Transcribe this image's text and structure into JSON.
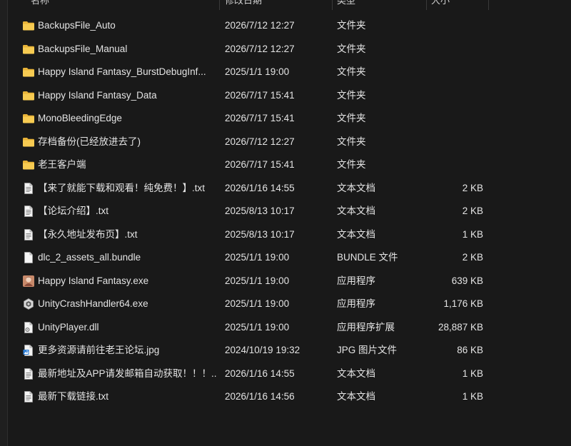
{
  "columns": {
    "name": "名称",
    "modified": "修改日期",
    "type": "类型",
    "size": "大小"
  },
  "files": [
    {
      "name": "BackupsFile_Auto",
      "date": "2026/7/12 12:27",
      "type": "文件夹",
      "size": "",
      "icon": "folder-icon"
    },
    {
      "name": "BackupsFile_Manual",
      "date": "2026/7/12 12:27",
      "type": "文件夹",
      "size": "",
      "icon": "folder-icon"
    },
    {
      "name": "Happy Island Fantasy_BurstDebugInf...",
      "date": "2025/1/1 19:00",
      "type": "文件夹",
      "size": "",
      "icon": "folder-icon"
    },
    {
      "name": "Happy Island Fantasy_Data",
      "date": "2026/7/17 15:41",
      "type": "文件夹",
      "size": "",
      "icon": "folder-icon"
    },
    {
      "name": "MonoBleedingEdge",
      "date": "2026/7/17 15:41",
      "type": "文件夹",
      "size": "",
      "icon": "folder-icon"
    },
    {
      "name": "存档备份(已经放进去了)",
      "date": "2026/7/12 12:27",
      "type": "文件夹",
      "size": "",
      "icon": "folder-icon"
    },
    {
      "name": "老王客户端",
      "date": "2026/7/17 15:41",
      "type": "文件夹",
      "size": "",
      "icon": "folder-icon"
    },
    {
      "name": "【来了就能下载和观看！纯免费！】.txt",
      "date": "2026/1/16 14:55",
      "type": "文本文档",
      "size": "2 KB",
      "icon": "text-file-icon"
    },
    {
      "name": "【论坛介绍】.txt",
      "date": "2025/8/13 10:17",
      "type": "文本文档",
      "size": "2 KB",
      "icon": "text-file-icon"
    },
    {
      "name": "【永久地址发布页】.txt",
      "date": "2025/8/13 10:17",
      "type": "文本文档",
      "size": "1 KB",
      "icon": "text-file-icon"
    },
    {
      "name": "dlc_2_assets_all.bundle",
      "date": "2025/1/1 19:00",
      "type": "BUNDLE 文件",
      "size": "2 KB",
      "icon": "blank-file-icon"
    },
    {
      "name": "Happy Island Fantasy.exe",
      "date": "2025/1/1 19:00",
      "type": "应用程序",
      "size": "639 KB",
      "icon": "app-exe-icon"
    },
    {
      "name": "UnityCrashHandler64.exe",
      "date": "2025/1/1 19:00",
      "type": "应用程序",
      "size": "1,176 KB",
      "icon": "unity-exe-icon"
    },
    {
      "name": "UnityPlayer.dll",
      "date": "2025/1/1 19:00",
      "type": "应用程序扩展",
      "size": "28,887 KB",
      "icon": "dll-file-icon"
    },
    {
      "name": "更多资源请前往老王论坛.jpg",
      "date": "2024/10/19 19:32",
      "type": "JPG 图片文件",
      "size": "86 KB",
      "icon": "image-file-icon"
    },
    {
      "name": "最新地址及APP请发邮箱自动获取！！！...",
      "date": "2026/1/16 14:55",
      "type": "文本文档",
      "size": "1 KB",
      "icon": "text-file-icon"
    },
    {
      "name": "最新下载链接.txt",
      "date": "2026/1/16 14:56",
      "type": "文本文档",
      "size": "1 KB",
      "icon": "text-file-icon"
    }
  ],
  "colors": {
    "background": "#191919",
    "text": "#e4e4e4",
    "folder": "#f2c14e"
  }
}
